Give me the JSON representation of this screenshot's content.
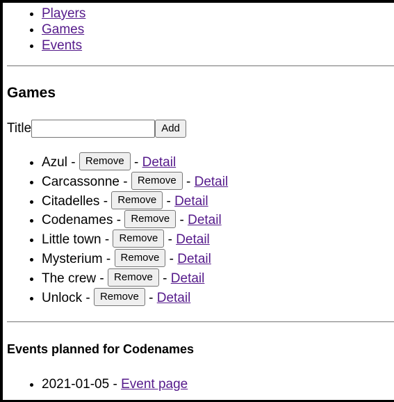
{
  "nav": {
    "items": [
      {
        "label": "Players"
      },
      {
        "label": "Games"
      },
      {
        "label": "Events"
      }
    ]
  },
  "games_section": {
    "heading": "Games",
    "add_form": {
      "title_label": "Title",
      "title_value": "",
      "add_button": "Add"
    },
    "games": [
      {
        "name": "Azul"
      },
      {
        "name": "Carcassonne"
      },
      {
        "name": "Citadelles"
      },
      {
        "name": "Codenames"
      },
      {
        "name": "Little town"
      },
      {
        "name": "Mysterium"
      },
      {
        "name": "The crew"
      },
      {
        "name": "Unlock"
      }
    ],
    "separator": "-",
    "remove_label": "Remove",
    "detail_label": "Detail"
  },
  "events_section": {
    "heading": "Events planned for Codenames",
    "events": [
      {
        "date": "2021-01-05",
        "link_label": "Event page"
      }
    ]
  },
  "colors": {
    "link": "#551a8b",
    "frame": "#000000",
    "button_bg": "#efefef"
  }
}
